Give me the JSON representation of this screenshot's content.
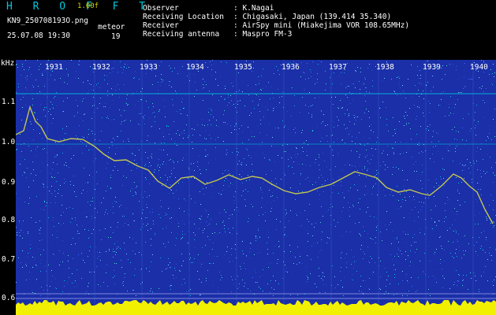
{
  "app": {
    "brand": "H R O F F T",
    "version": "1.00f",
    "filename": "KN9_250708193O.png",
    "datetime": "25.07.08 19:30",
    "meteor_label": "meteor",
    "meteor_count": "19"
  },
  "info": {
    "labels": [
      "Observer",
      "Receiving Location",
      "Receiver",
      "Receiving antenna"
    ],
    "values": [
      ": K.Nagai",
      ": Chigasaki, Japan (139.414 35.340)",
      ": AirSpy mini (Miakejima VOR 108.65MHz)",
      ": Maspro FM-3"
    ]
  },
  "axis": {
    "unit": "kHz",
    "y_ticks": [
      "1.1",
      "1.0",
      "0.9",
      "0.8",
      "0.7",
      "0.6"
    ],
    "x_ticks": [
      "1931",
      "1932",
      "1933",
      "1934",
      "1935",
      "1936",
      "1937",
      "1938",
      "1939",
      "1940"
    ]
  },
  "colors": {
    "background_noise": "#1a2fa8",
    "trace": "#e0e040",
    "baseline": "#f0f000",
    "cyan": "#00d0e0",
    "axis_text": "#ffffff"
  }
}
